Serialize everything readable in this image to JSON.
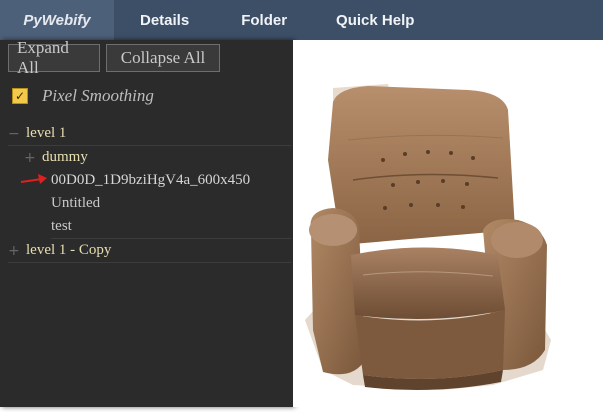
{
  "nav": {
    "brand": "PyWebify",
    "items": [
      "Details",
      "Folder",
      "Quick Help"
    ]
  },
  "sidebar": {
    "expand_all": "Expand All",
    "collapse_all": "Collapse All",
    "pixel_smoothing": "Pixel Smoothing",
    "pixel_smoothing_checked": true,
    "tree": [
      {
        "label": "level 1",
        "expander": "−",
        "kind": "folder"
      },
      {
        "label": "dummy",
        "expander": "+",
        "kind": "folder"
      },
      {
        "label": "00D0D_1D9bziHgV4a_600x450",
        "expander": "",
        "kind": "item-selected"
      },
      {
        "label": "Untitled",
        "expander": "",
        "kind": "item"
      },
      {
        "label": "test",
        "expander": "",
        "kind": "item"
      },
      {
        "label": "level 1 - Copy",
        "expander": "+",
        "kind": "folder"
      }
    ]
  },
  "colors": {
    "topbar": "#3d4f66",
    "brand_bg": "#4d6079",
    "sidebar_bg": "#2b2b2b",
    "checkbox": "#f3c94a",
    "arrow": "#e0201e"
  },
  "viewer": {
    "image": "armchair-photo"
  }
}
